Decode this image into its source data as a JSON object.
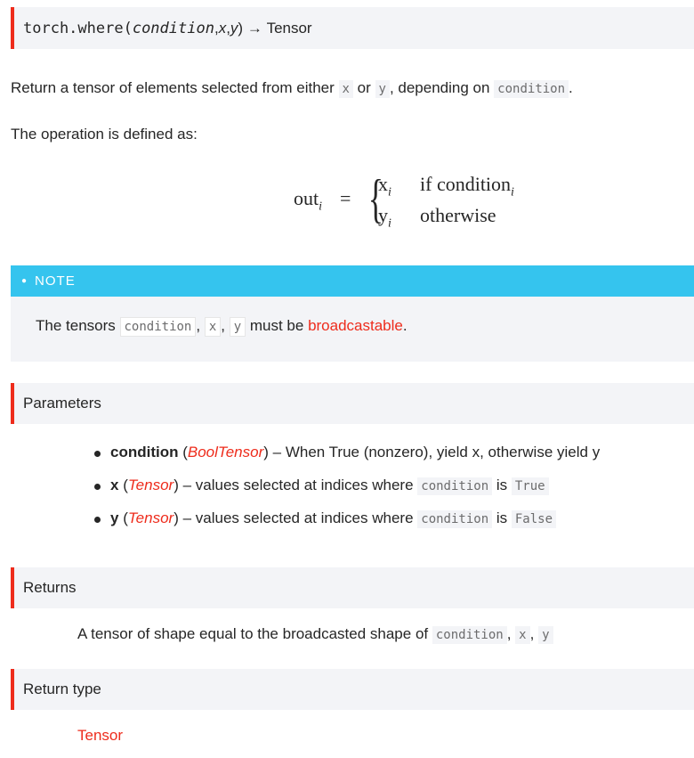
{
  "signature": {
    "module": "torch.where(",
    "params": "condition",
    "sep1": ", ",
    "x": "x",
    "sep2": ", ",
    "y": "y",
    "close": ")",
    "arrow": "→",
    "returns": "Tensor"
  },
  "intro": {
    "pre": "Return a tensor of elements selected from either ",
    "x": "x",
    "or": " or ",
    "y": "y",
    "mid": ", depending on ",
    "cond": "condition",
    "end": "."
  },
  "defined": "The operation is defined as:",
  "formula": {
    "lhs": "out",
    "sub": "i",
    "eq": "=",
    "row1_val": "x",
    "row1_sub": "i",
    "row1_cond": "if condition",
    "row1_cond_sub": "i",
    "row2_val": "y",
    "row2_sub": "i",
    "row2_cond": "otherwise"
  },
  "note": {
    "title": "NOTE",
    "pre": "The tensors ",
    "c": "condition",
    "comma": ", ",
    "x": "x",
    "y": "y",
    "mid": " must be ",
    "link": "broadcastable",
    "end": "."
  },
  "parameters": {
    "title": "Parameters",
    "items": [
      {
        "name": "condition",
        "type": "BoolTensor",
        "desc": " – When True (nonzero), yield x, otherwise yield y"
      },
      {
        "name": "x",
        "type": "Tensor",
        "desc": " – values selected at indices where ",
        "code": "condition",
        "is": " is ",
        "val": "True"
      },
      {
        "name": "y",
        "type": "Tensor",
        "desc": " – values selected at indices where ",
        "code": "condition",
        "is": " is ",
        "val": "False"
      }
    ]
  },
  "returns": {
    "title": "Returns",
    "text": "A tensor of shape equal to the broadcasted shape of ",
    "c": "condition",
    "x": "x",
    "y": "y",
    "comma": ", "
  },
  "return_type": {
    "title": "Return type",
    "value": "Tensor"
  },
  "colors": {
    "accent": "#ee2c1c",
    "note": "#35c4ee",
    "panel": "#f3f4f7"
  }
}
